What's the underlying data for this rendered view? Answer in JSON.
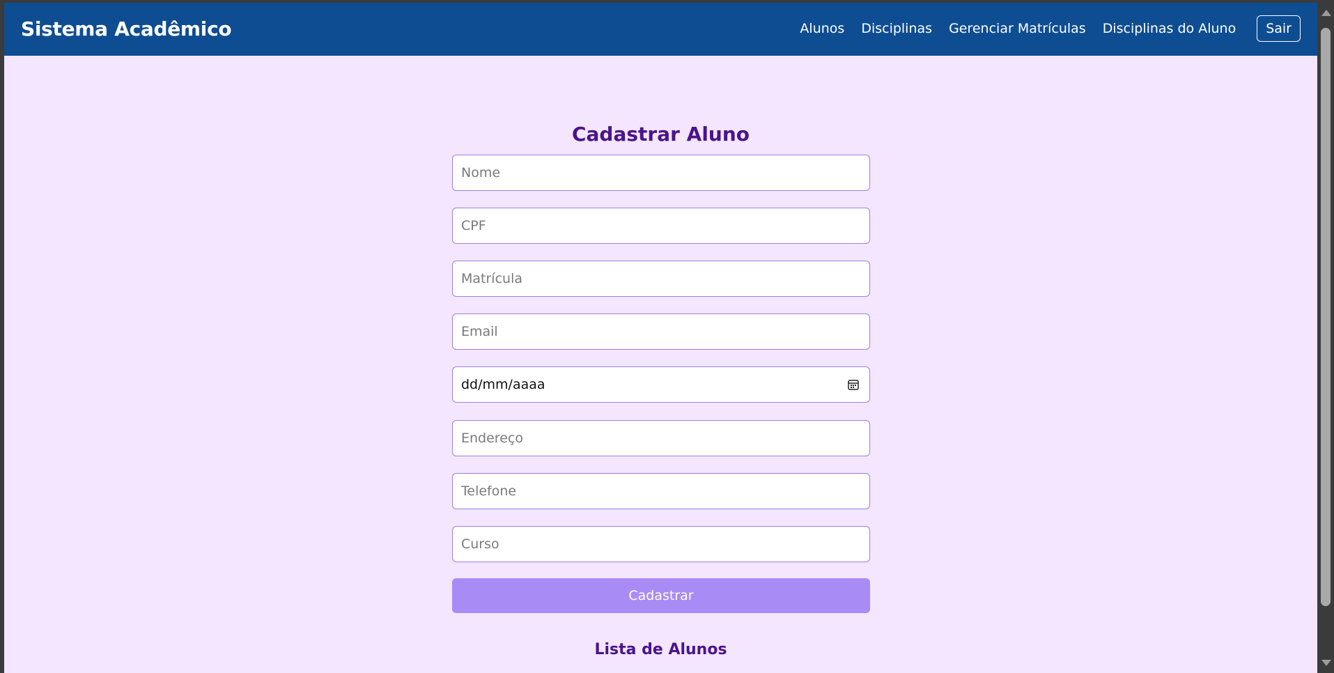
{
  "navbar": {
    "brand": "Sistema Acadêmico",
    "links": [
      {
        "label": "Alunos"
      },
      {
        "label": "Disciplinas"
      },
      {
        "label": "Gerenciar Matrículas"
      },
      {
        "label": "Disciplinas do Aluno"
      }
    ],
    "logout_label": "Sair",
    "background_color": "#0e4d92"
  },
  "form": {
    "title": "Cadastrar Aluno",
    "fields": {
      "nome": {
        "placeholder": "Nome",
        "value": ""
      },
      "cpf": {
        "placeholder": "CPF",
        "value": ""
      },
      "matricula": {
        "placeholder": "Matrícula",
        "value": ""
      },
      "email": {
        "placeholder": "Email",
        "value": ""
      },
      "data_nascimento": {
        "display": "dd/mm/aaaa",
        "icon": "calendar-icon"
      },
      "endereco": {
        "placeholder": "Endereço",
        "value": ""
      },
      "telefone": {
        "placeholder": "Telefone",
        "value": ""
      },
      "curso": {
        "placeholder": "Curso",
        "value": ""
      }
    },
    "submit_label": "Cadastrar",
    "submit_color": "#a98bf6"
  },
  "list": {
    "title": "Lista de Alunos"
  },
  "theme": {
    "page_background": "#f3e6fe",
    "title_color": "#4a148c",
    "field_border": "#9c7ee8"
  }
}
